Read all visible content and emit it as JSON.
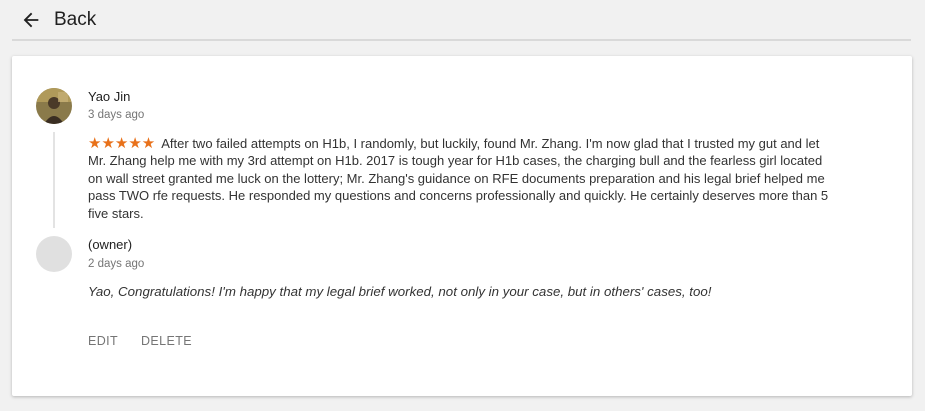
{
  "header": {
    "back_label": "Back",
    "back_icon": "arrow-left-icon"
  },
  "review": {
    "author": "Yao Jin",
    "time": "3 days ago",
    "rating": 5,
    "stars": "★★★★★",
    "star_color": "#e8711a",
    "text": "After two failed attempts on H1b, I randomly, but luckily, found Mr. Zhang. I'm now glad that I trusted my gut and let Mr. Zhang help me with my 3rd attempt on H1b. 2017 is tough year for H1b cases, the charging bull and the fearless girl located on wall street granted me luck on the lottery; Mr. Zhang's guidance on RFE documents preparation and his legal brief helped me pass TWO rfe requests. He responded my questions and concerns professionally and quickly. He certainly deserves more than 5 five stars."
  },
  "reply": {
    "author": "(owner)",
    "time": "2 days ago",
    "text": "Yao, Congratulations! I'm happy that my legal brief worked, not only in your case, but in others' cases, too!"
  },
  "actions": {
    "edit_label": "EDIT",
    "delete_label": "DELETE"
  }
}
